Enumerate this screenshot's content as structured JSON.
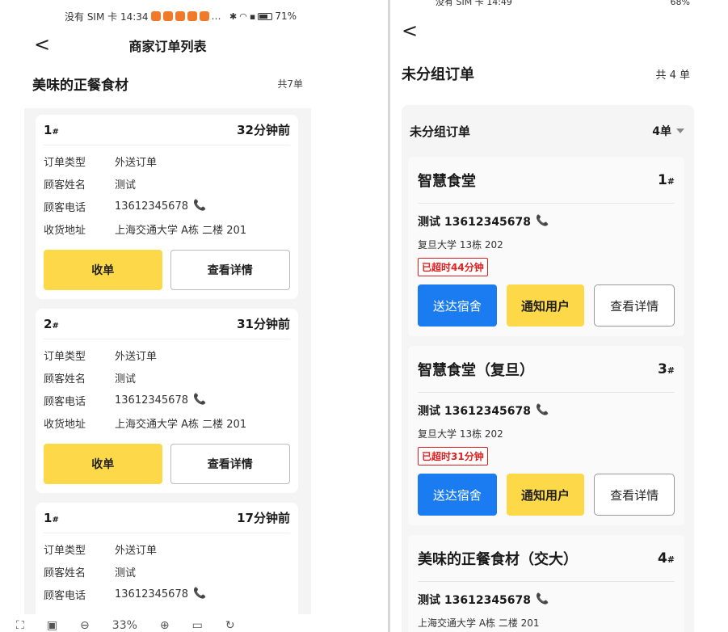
{
  "left": {
    "status_bar": {
      "carrier_time": "没有 SIM 卡 14:34",
      "more": "…",
      "battery": "71%",
      "battery_level": 0.71
    },
    "nav": {
      "back": "<",
      "title": "商家订单列表"
    },
    "shop": {
      "name": "美味的正餐食材",
      "count": "共7单"
    },
    "field_labels": {
      "type": "订单类型",
      "name": "顾客姓名",
      "phone": "顾客电话",
      "address": "收货地址"
    },
    "orders": [
      {
        "num": "1",
        "hash": "#",
        "ago": "32分钟前",
        "type": "外送订单",
        "name": "测试",
        "phone": "13612345678",
        "address": "上海交通大学 A栋 二楼 201",
        "accept": "收单",
        "detail": "查看详情"
      },
      {
        "num": "2",
        "hash": "#",
        "ago": "31分钟前",
        "type": "外送订单",
        "name": "测试",
        "phone": "13612345678",
        "address": "上海交通大学 A栋 二楼 201",
        "accept": "收单",
        "detail": "查看详情"
      },
      {
        "num": "1",
        "hash": "#",
        "ago": "17分钟前",
        "type": "外送订单",
        "name": "测试",
        "phone": "13612345678"
      }
    ],
    "toolbar": {
      "zoom": "33%"
    }
  },
  "right": {
    "status_bar": {
      "carrier_time": "没有 SIM 卡 14:49",
      "battery": "68%"
    },
    "nav": {
      "back": "<"
    },
    "header": {
      "title": "未分组订单",
      "count": "共 4 单"
    },
    "group": {
      "title": "未分组订单",
      "count": "4单"
    },
    "cards": [
      {
        "name": "智慧食堂",
        "num": "1",
        "hash": "#",
        "customer": "测试 13612345678",
        "address": "复旦大学 13栋 202",
        "overtime": "已超时44分钟",
        "deliver": "送达宿舍",
        "notify": "通知用户",
        "detail": "查看详情"
      },
      {
        "name": "智慧食堂（复旦）",
        "num": "3",
        "hash": "#",
        "customer": "测试 13612345678",
        "address": "复旦大学 13栋 202",
        "overtime": "已超时31分钟",
        "deliver": "送达宿舍",
        "notify": "通知用户",
        "detail": "查看详情"
      },
      {
        "name": "美味的正餐食材（交大）",
        "num": "4",
        "hash": "#",
        "customer": "测试 13612345678",
        "address": "上海交通大学 A栋 二楼 201"
      }
    ]
  },
  "colors": {
    "yellow": "#fdd94a",
    "blue": "#1a7cf0",
    "red": "#e02020",
    "bg": "#f4f4f4"
  }
}
